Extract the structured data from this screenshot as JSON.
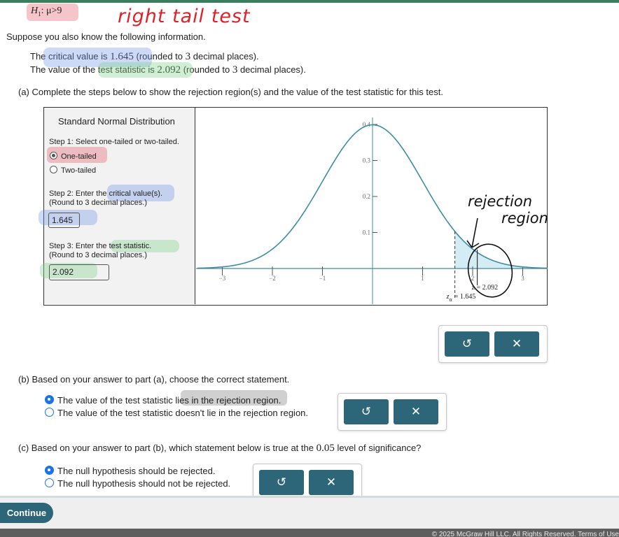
{
  "header": {
    "hypothesis_symbol": "H",
    "hypothesis_sub": "1",
    "hypothesis_rest": ": μ>9",
    "handwritten_note": "right tail test"
  },
  "intro": {
    "lead": "Suppose you also know the following information.",
    "critical_pre": "The critical value is ",
    "critical_value": "1.645",
    "critical_mid": " (rounded to ",
    "critical_dec": "3",
    "critical_post": " decimal places).",
    "stat_pre": "The value of the test statistic is ",
    "stat_value": "2.092",
    "stat_mid": " (rounded to ",
    "stat_dec": "3",
    "stat_post": " decimal places)."
  },
  "part_a": {
    "prompt": "(a) Complete the steps below to show the rejection region(s) and the value of the test statistic for this test.",
    "panel_title": "Standard Normal Distribution",
    "step1": "Step 1: Select one-tailed or two-tailed.",
    "option_one": "One-tailed",
    "option_two": "Two-tailed",
    "step2_line1": "Step 2: Enter the critical value(s).",
    "step2_line2": "(Round to 3 decimal places.)",
    "critical_input": "1.645",
    "step3_line1": "Step 3: Enter the test statistic.",
    "step3_line2": "(Round to 3 decimal places.)",
    "stat_input": "2.092",
    "graph_z_label": "z = 2.092",
    "graph_za_label": "z",
    "graph_za_sub": "α",
    "graph_za_value": "= 1.645",
    "annotation_line1": "rejection",
    "annotation_line2": "region"
  },
  "part_b": {
    "prompt": "(b) Based on your answer to part (a), choose the correct statement.",
    "opt1_pre": "The value of the test statistic ",
    "opt1_hl": "lies in the rejection region",
    "opt1_post": ".",
    "opt2": "The value of the test statistic doesn't lie in the rejection region."
  },
  "part_c": {
    "prompt_pre": "(c) Based on your answer to part (b), which statement below is true at the ",
    "prompt_level": "0.05",
    "prompt_post": " level of significance?",
    "opt1": "The null hypothesis should be rejected.",
    "opt2": "The null hypothesis should not be rejected."
  },
  "buttons": {
    "undo_icon": "↺",
    "clear_icon": "✕",
    "continue_label": "Continue"
  },
  "footer": {
    "copyright": "© 2025 McGraw Hill LLC. All Rights Reserved.   Terms of Use"
  },
  "chart_data": {
    "type": "area",
    "distribution": "standard normal",
    "x_ticks": [
      -3,
      -2,
      -1,
      1,
      2,
      3
    ],
    "x_tick_labels": [
      "−3",
      "−2",
      "−1",
      "1",
      "2",
      "3"
    ],
    "y_ticks": [
      0.1,
      0.2,
      0.3,
      0.4
    ],
    "y_tick_labels": [
      "0.1",
      "0.2",
      "0.3",
      "0.4"
    ],
    "xlim": [
      -3.5,
      3.5
    ],
    "ylim": [
      0,
      0.42
    ],
    "critical_value": 1.645,
    "test_statistic": 2.092,
    "shaded_region": [
      1.645,
      3.5
    ],
    "colors": {
      "curve": "#3d8ca6",
      "shade": "#d4ecf3"
    }
  }
}
